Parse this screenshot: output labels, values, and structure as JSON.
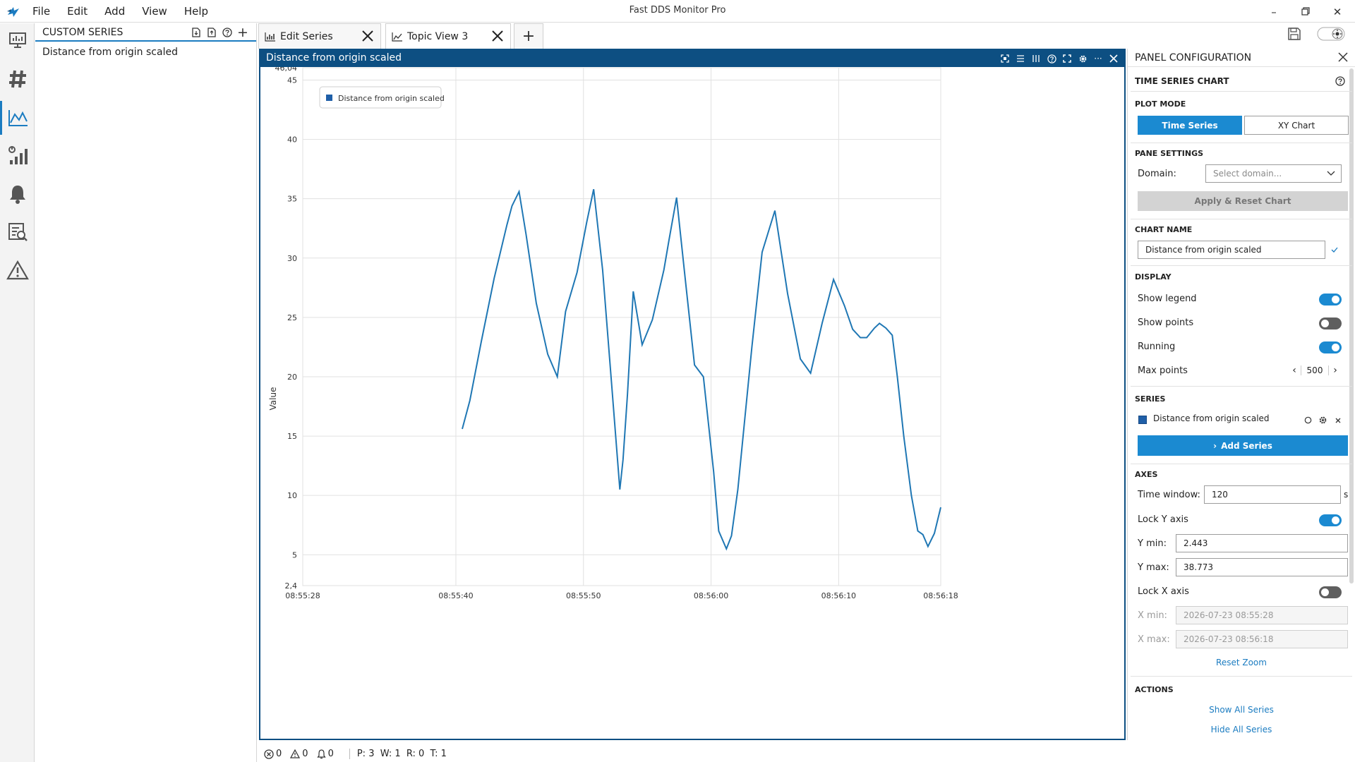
{
  "app": {
    "title": "Fast DDS Monitor Pro",
    "menu": [
      "File",
      "Edit",
      "Add",
      "View",
      "Help"
    ]
  },
  "rail": {
    "items": [
      "dashboard-icon",
      "topics-hash-icon",
      "chart-line-icon",
      "statistics-bar-icon",
      "alerts-bell-icon",
      "logs-icon",
      "issues-warning-icon"
    ],
    "active_index": 2
  },
  "custom_series": {
    "title": "CUSTOM SERIES",
    "items": [
      "Distance from origin scaled"
    ]
  },
  "tabs": [
    {
      "label": "Edit Series",
      "icon": "chart-bar-icon"
    },
    {
      "label": "Topic View 3",
      "icon": "chart-line-icon"
    }
  ],
  "chart_window": {
    "title": "Distance from origin scaled"
  },
  "chart_data": {
    "type": "line",
    "ylabel": "Value",
    "legend": {
      "entries": [
        "Distance from origin scaled"
      ],
      "placement": "top-left"
    },
    "ylim": [
      2.4,
      46.04
    ],
    "y_ticks": [
      "46,04",
      "45",
      "40",
      "35",
      "30",
      "25",
      "20",
      "15",
      "10",
      "5",
      "2,4"
    ],
    "y_tick_values": [
      46.04,
      45,
      40,
      35,
      30,
      25,
      20,
      15,
      10,
      5,
      2.4
    ],
    "xlim": [
      "08:55:28",
      "08:56:18"
    ],
    "x_ticks": [
      "08:55:28",
      "08:55:40",
      "08:55:50",
      "08:56:00",
      "08:56:10",
      "08:56:18"
    ],
    "x_tick_values_s": [
      0,
      12,
      22,
      32,
      42,
      50
    ],
    "grid": true,
    "series": [
      {
        "name": "Distance from origin scaled",
        "color": "#1f77b4",
        "x_s": [
          12.5,
          13.1,
          14.0,
          15.0,
          16.0,
          16.4,
          16.95,
          17.5,
          18.3,
          19.2,
          19.95,
          20.6,
          21.5,
          22.25,
          22.8,
          23.5,
          24.2,
          24.85,
          25.1,
          25.45,
          25.9,
          26.6,
          27.4,
          28.3,
          28.7,
          29.3,
          30.0,
          30.7,
          31.4,
          32.2,
          32.6,
          33.2,
          33.6,
          34.1,
          34.6,
          35.2,
          36.0,
          37.0,
          38.0,
          39.0,
          39.8,
          40.7,
          41.6,
          42.45,
          43.1,
          43.7,
          44.2,
          44.8,
          45.2,
          45.7,
          46.2,
          46.6,
          47.1,
          47.7,
          48.2,
          48.6,
          49.0,
          49.5,
          50.0
        ],
        "y": [
          15.6,
          18.0,
          23.0,
          28.3,
          32.8,
          34.4,
          35.6,
          32.0,
          26.2,
          21.9,
          20.0,
          25.5,
          28.8,
          33.0,
          35.8,
          29.0,
          19.5,
          10.5,
          13.0,
          18.5,
          27.2,
          22.7,
          24.8,
          29.0,
          31.5,
          35.1,
          28.0,
          21.0,
          20.0,
          12.0,
          7.0,
          5.5,
          6.6,
          10.5,
          16.0,
          22.5,
          30.5,
          34.0,
          27.0,
          21.5,
          20.3,
          24.5,
          28.2,
          26.0,
          24.0,
          23.3,
          23.3,
          24.1,
          24.5,
          24.1,
          23.5,
          20.0,
          15.0,
          10.0,
          7.0,
          6.7,
          5.7,
          6.8,
          9.0
        ]
      }
    ]
  },
  "config": {
    "title": "PANEL CONFIGURATION",
    "chart_section": "TIME SERIES CHART",
    "plot_mode": {
      "section": "PLOT MODE",
      "time_series": "Time Series",
      "xy_chart": "XY Chart"
    },
    "pane_settings": {
      "section": "PANE SETTINGS",
      "domain_label": "Domain:",
      "domain_placeholder": "Select domain...",
      "apply_label": "Apply & Reset Chart"
    },
    "chart_name": {
      "section": "CHART NAME",
      "value": "Distance from origin scaled"
    },
    "display": {
      "section": "DISPLAY",
      "show_legend": "Show legend",
      "show_points": "Show points",
      "running": "Running",
      "max_points_label": "Max points",
      "max_points_value": "500"
    },
    "series": {
      "section": "SERIES",
      "name": "Distance from origin scaled",
      "color": "#1f5fa8",
      "add_label": "Add Series"
    },
    "axes": {
      "section": "AXES",
      "time_window_label": "Time window:",
      "time_window_value": "120",
      "time_window_unit": "s",
      "lock_y_label": "Lock Y axis",
      "y_min_label": "Y min:",
      "y_min_value": "2.443",
      "y_max_label": "Y max:",
      "y_max_value": "38.773",
      "lock_x_label": "Lock X axis",
      "x_min_label": "X min:",
      "x_min_value": "2026-07-23 08:55:28",
      "x_max_label": "X max:",
      "x_max_value": "2026-07-23 08:56:18",
      "reset_zoom": "Reset Zoom"
    },
    "actions": {
      "section": "ACTIONS",
      "show_all": "Show All Series",
      "hide_all": "Hide All Series"
    }
  },
  "status": {
    "errors": "0",
    "warnings": "0",
    "notifications": "0",
    "counts": "P: 3  W: 1  R: 0  T: 1"
  }
}
